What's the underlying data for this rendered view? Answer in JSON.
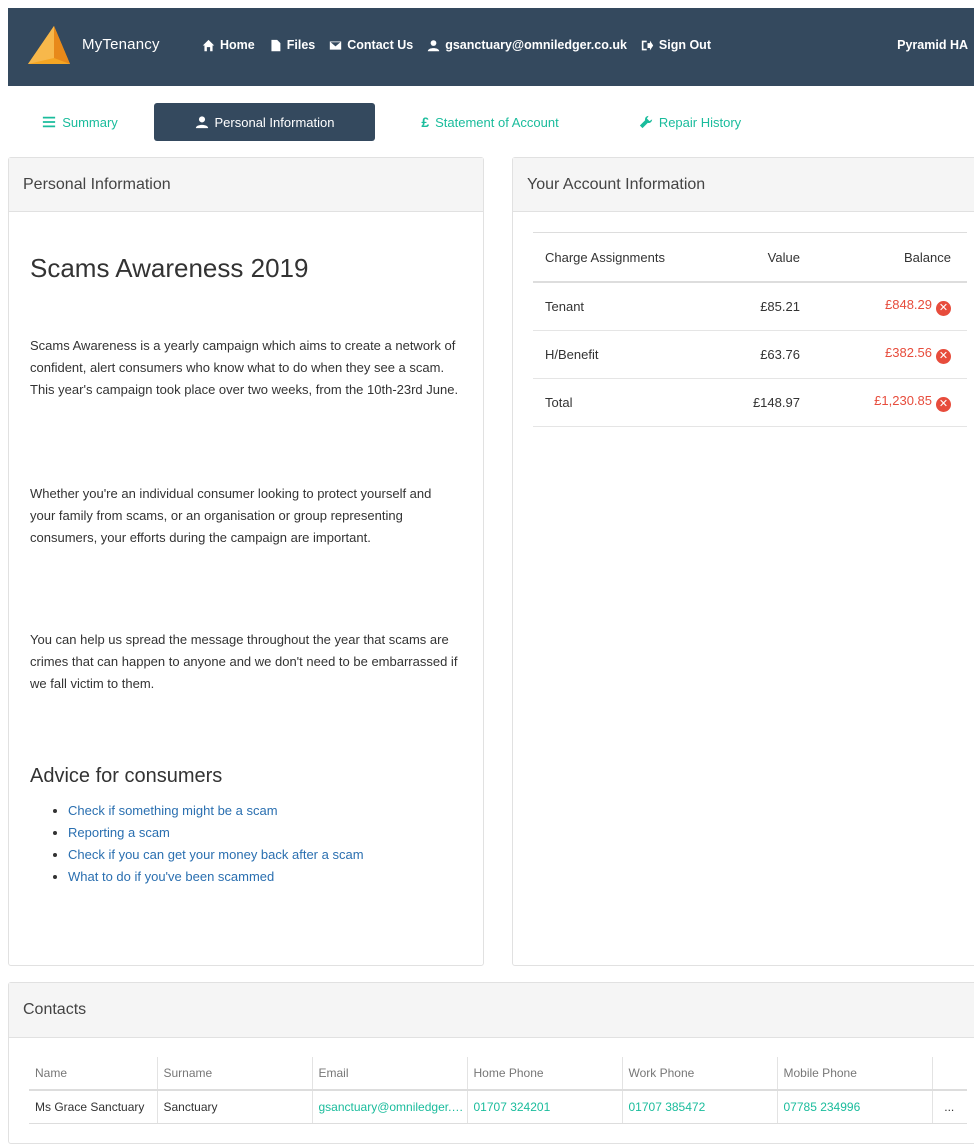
{
  "navbar": {
    "brand": "MyTenancy",
    "links": [
      {
        "label": "Home",
        "icon": "home-icon"
      },
      {
        "label": "Files",
        "icon": "file-icon"
      },
      {
        "label": "Contact Us",
        "icon": "envelope-icon"
      },
      {
        "label": "gsanctuary@omniledger.co.uk",
        "icon": "user-icon"
      },
      {
        "label": "Sign Out",
        "icon": "sign-out-icon"
      }
    ],
    "org": "Pyramid HA"
  },
  "tabs": [
    {
      "label": "Summary",
      "icon": "list-icon",
      "active": false
    },
    {
      "label": "Personal Information",
      "icon": "user-icon",
      "active": true
    },
    {
      "label": "Statement of Account",
      "icon": "pound-icon",
      "active": false
    },
    {
      "label": "Repair History",
      "icon": "wrench-icon",
      "active": false
    }
  ],
  "personal_panel": {
    "heading": "Personal Information",
    "article_title": "Scams Awareness 2019",
    "paragraphs": [
      "Scams Awareness is a yearly campaign which aims to create a network of confident, alert consumers who know what to do when they see a scam. This year's campaign took place over two weeks, from the 10th-23rd June.",
      "Whether you're an individual consumer looking to protect yourself and your family from scams, or an organisation or group representing consumers, your efforts during the campaign are important.",
      "You can help us spread the message throughout the year that scams are crimes that can happen to anyone and we don't need to be embarrassed if we fall victim to them."
    ],
    "advice_heading": "Advice for consumers",
    "advice_links": [
      "Check if something might be a scam",
      "Reporting a scam",
      "Check if you can get your money back after a scam",
      "What to do if you've been scammed"
    ]
  },
  "account_panel": {
    "heading": "Your Account Information",
    "columns": [
      "Charge Assignments",
      "Value",
      "Balance"
    ],
    "rows": [
      {
        "assignment": "Tenant",
        "value": "£85.21",
        "balance": "£848.29"
      },
      {
        "assignment": "H/Benefit",
        "value": "£63.76",
        "balance": "£382.56"
      },
      {
        "assignment": "Total",
        "value": "£148.97",
        "balance": "£1,230.85"
      }
    ],
    "status_color": "#e74c3c"
  },
  "contacts_panel": {
    "heading": "Contacts",
    "columns": [
      "Name",
      "Surname",
      "Email",
      "Home Phone",
      "Work Phone",
      "Mobile Phone",
      ""
    ],
    "rows": [
      {
        "name": "Ms Grace Sanctuary",
        "surname": "Sanctuary",
        "email": "gsanctuary@omniledger.co.uk",
        "home": "01707 324201",
        "work": "01707 385472",
        "mobile": "07785 234996",
        "actions": "..."
      }
    ]
  },
  "colors": {
    "navbar": "#34495e",
    "accent": "#1abc9c",
    "link": "#2a6fb0",
    "negative": "#e74c3c"
  }
}
